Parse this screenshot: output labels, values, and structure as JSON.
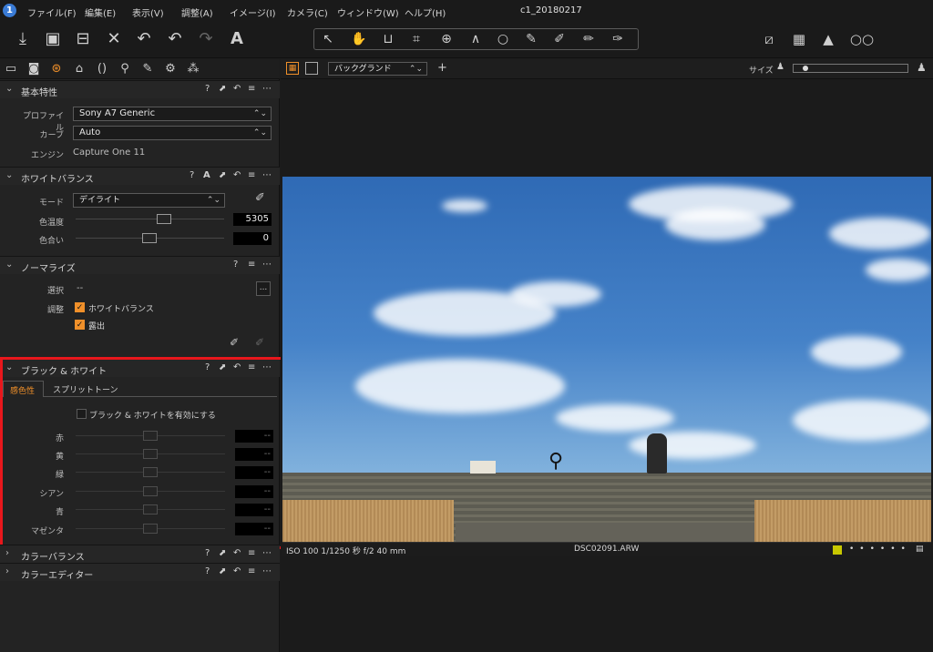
{
  "menu": {
    "logo": "1",
    "items": [
      "ファイル(F)",
      "編集(E)",
      "表示(V)",
      "調整(A)",
      "イメージ(I)",
      "カメラ(C)",
      "ウィンドウ(W)",
      "ヘルプ(H)"
    ],
    "window_title": "c1_20180217"
  },
  "viewer_toolbar": {
    "background_select": "バックグランド",
    "size_label": "サイズ"
  },
  "sections": {
    "basic": {
      "title": "基本特性",
      "profile_label": "プロファイル",
      "profile_value": "Sony A7 Generic",
      "curve_label": "カーブ",
      "curve_value": "Auto",
      "engine_label": "エンジン",
      "engine_value": "Capture One 11"
    },
    "white_balance": {
      "title": "ホワイトバランス",
      "mode_label": "モード",
      "mode_value": "デイライト",
      "temp_label": "色温度",
      "temp_value": "5305",
      "tint_label": "色合い",
      "tint_value": "0"
    },
    "normalize": {
      "title": "ノーマライズ",
      "select_label": "選択",
      "select_value": "--",
      "adjust_label": "調整",
      "check1": "ホワイトバランス",
      "check2": "露出",
      "dots": "..."
    },
    "bw": {
      "title": "ブラック & ホワイト",
      "tab1": "感色性",
      "tab2": "スプリットトーン",
      "enable_label": "ブラック & ホワイトを有効にする",
      "rows": [
        {
          "label": "赤",
          "value": "--"
        },
        {
          "label": "黄",
          "value": "--"
        },
        {
          "label": "緑",
          "value": "--"
        },
        {
          "label": "シアン",
          "value": "--"
        },
        {
          "label": "青",
          "value": "--"
        },
        {
          "label": "マゼンタ",
          "value": "--"
        }
      ]
    },
    "color_balance": {
      "title": "カラーバランス"
    },
    "color_editor": {
      "title": "カラーエディター"
    }
  },
  "viewer": {
    "exif": "ISO 100  1/1250 秒  f/2  40 mm",
    "filename": "DSC02091.ARW"
  },
  "colors": {
    "accent": "#f0902a",
    "highlight_border": "#e8171c",
    "panel_bg": "#232323",
    "color_tag": "#c8c800"
  }
}
